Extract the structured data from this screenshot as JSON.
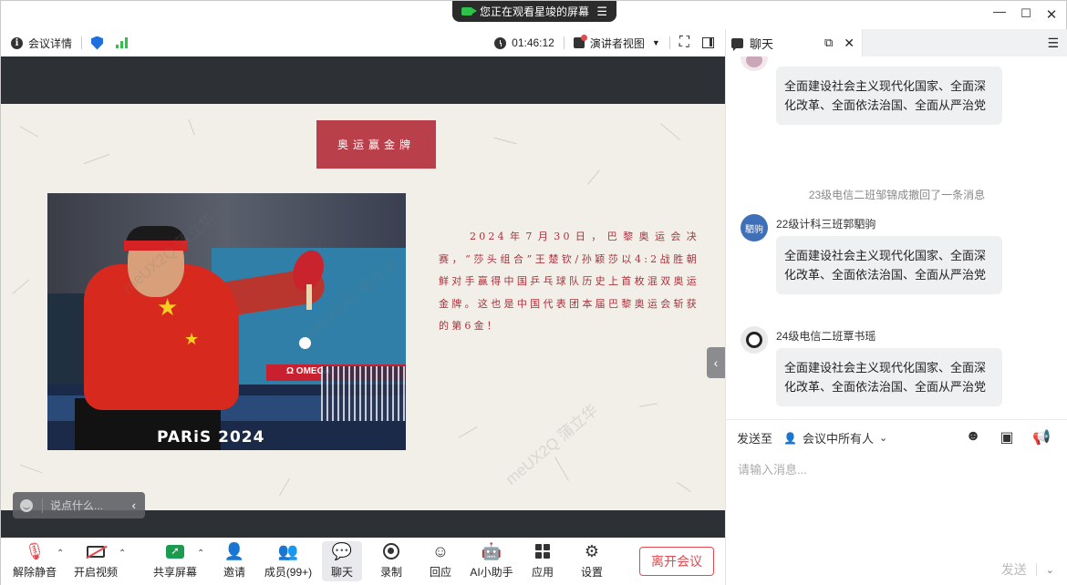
{
  "titlebar": {
    "share_notice": "您正在观看星竣的屏幕",
    "menu_icon": "hamburger-icon",
    "controls": [
      "minimize-icon",
      "maximize-icon",
      "close-icon"
    ]
  },
  "meeting_toolbar": {
    "details_label": "会议详情",
    "timer": "01:46:12",
    "view_mode_label": "演讲者视图"
  },
  "slide": {
    "title": "奥运赢金牌",
    "photo_caption": "PARiS 2024",
    "photo_sponsor": "Ω OMEGA",
    "body_text": "2024年7月30日，巴黎奥运会决赛，“莎头组合”王楚钦/孙颖莎以4:2战胜朝鲜对手赢得中国乒乓球队历史上首枚混双奥运金牌。这也是中国代表团本届巴黎奥运会斩获的第6金！",
    "watermarks": [
      "meUX2Q 蒲立华",
      "meUX2Q 蒲立华",
      "meUX2Q 蒲立华"
    ]
  },
  "quick_chat": {
    "placeholder": "说点什么..."
  },
  "bottom_toolbar": {
    "buttons": [
      {
        "label": "解除静音",
        "icon": "mic-muted-icon"
      },
      {
        "label": "开启视频",
        "icon": "video-off-icon"
      },
      {
        "label": "共享屏幕",
        "icon": "share-screen-icon"
      },
      {
        "label": "邀请",
        "icon": "invite-icon"
      },
      {
        "label": "成员(99+)",
        "icon": "members-icon"
      },
      {
        "label": "聊天",
        "icon": "chat-icon"
      },
      {
        "label": "录制",
        "icon": "record-icon"
      },
      {
        "label": "回应",
        "icon": "reaction-icon"
      },
      {
        "label": "AI小助手",
        "icon": "ai-assistant-icon"
      },
      {
        "label": "应用",
        "icon": "apps-icon"
      },
      {
        "label": "设置",
        "icon": "settings-icon"
      }
    ],
    "leave_label": "离开会议"
  },
  "chat": {
    "tab_label": "聊天",
    "messages": [
      {
        "sender": "",
        "text": "全面建设社会主义现代化国家、全面深化改革、全面依法治国、全面从严治党"
      },
      {
        "sender": "22级计科三班郭駟驹",
        "avatar_text": "駟驹",
        "text": "全面建设社会主义现代化国家、全面深化改革、全面依法治国、全面从严治党"
      },
      {
        "sender": "24级电信二班覃书瑶",
        "text": "全面建设社会主义现代化国家、全面深化改革、全面依法治国、全面从严治党"
      }
    ],
    "recall_notice": "23级电信二班邹锦成撤回了一条消息",
    "send_to_label": "发送至",
    "recipient": "会议中所有人",
    "input_placeholder": "请输入消息...",
    "send_label": "发送"
  },
  "colors": {
    "accent_red": "#e5484d",
    "slide_title_bg": "#b9404a",
    "slide_text": "#a8323c",
    "chat_bubble": "#eff0f2",
    "signal_green": "#2ec24b",
    "shield_blue": "#1f6fde"
  }
}
